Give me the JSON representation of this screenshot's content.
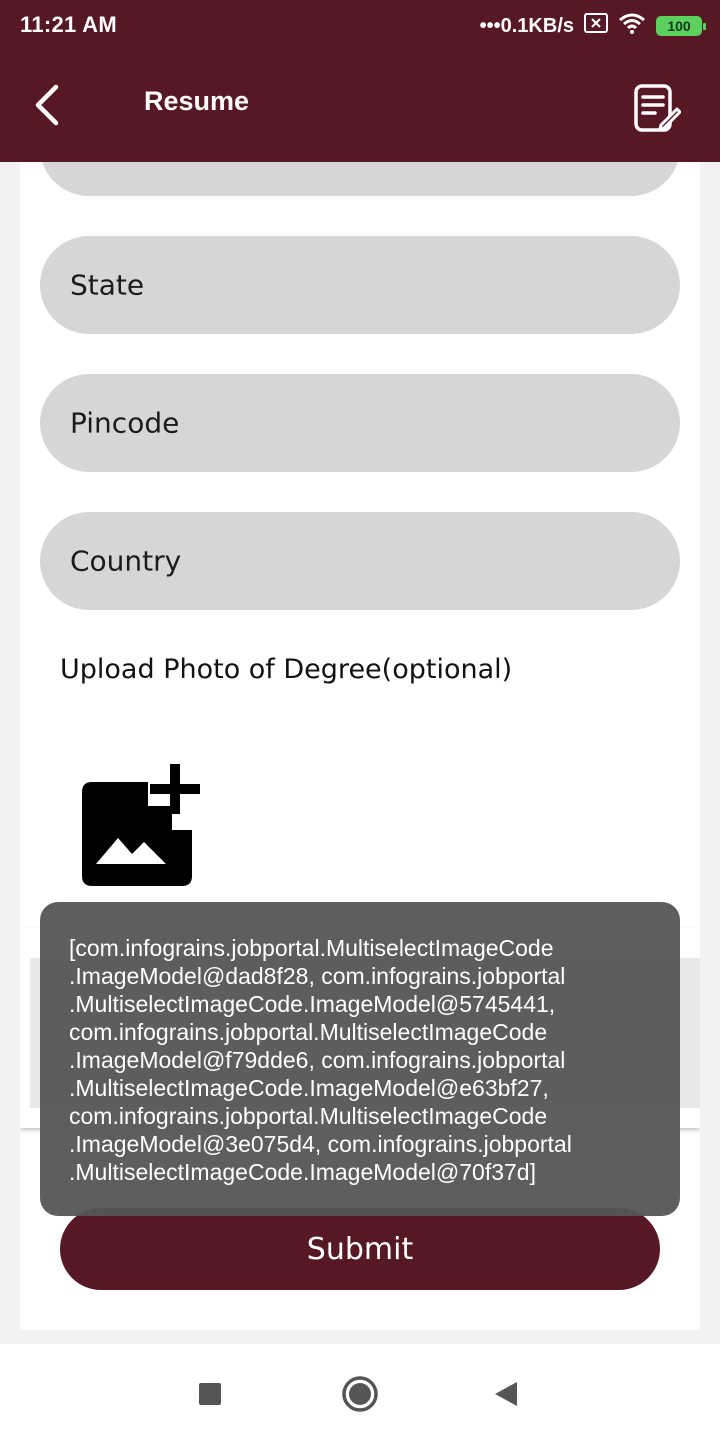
{
  "status_bar": {
    "time": "11:21 AM",
    "network_speed": "•••0.1KB/s",
    "battery": "100",
    "icons": [
      "sim-x-icon",
      "wifi-icon",
      "battery-icon"
    ]
  },
  "app_bar": {
    "title": "Resume",
    "back_icon": "back-arrow-icon",
    "action_icon": "edit-document-icon"
  },
  "form": {
    "fields": [
      {
        "label": "State"
      },
      {
        "label": "Pincode"
      },
      {
        "label": "Country"
      }
    ],
    "upload_label": "Upload Photo of Degree(optional)",
    "upload_icon": "add-photo-icon",
    "submit_label": "Submit"
  },
  "toast": {
    "message": "[com.infograins.jobportal.MultiselectImageCode\n.ImageModel@dad8f28, com.infograins.jobportal\n.MultiselectImageCode.ImageModel@5745441,\ncom.infograins.jobportal.MultiselectImageCode\n.ImageModel@f79dde6, com.infograins.jobportal\n.MultiselectImageCode.ImageModel@e63bf27,\ncom.infograins.jobportal.MultiselectImageCode\n.ImageModel@3e075d4, com.infograins.jobportal\n.MultiselectImageCode.ImageModel@70f37d]"
  },
  "nav_bar": {
    "icons": [
      "recents-square-icon",
      "home-circle-icon",
      "back-triangle-icon"
    ]
  },
  "colors": {
    "primary": "#561824",
    "field_bg": "#d6d6d6",
    "toast_bg": "#555555"
  }
}
